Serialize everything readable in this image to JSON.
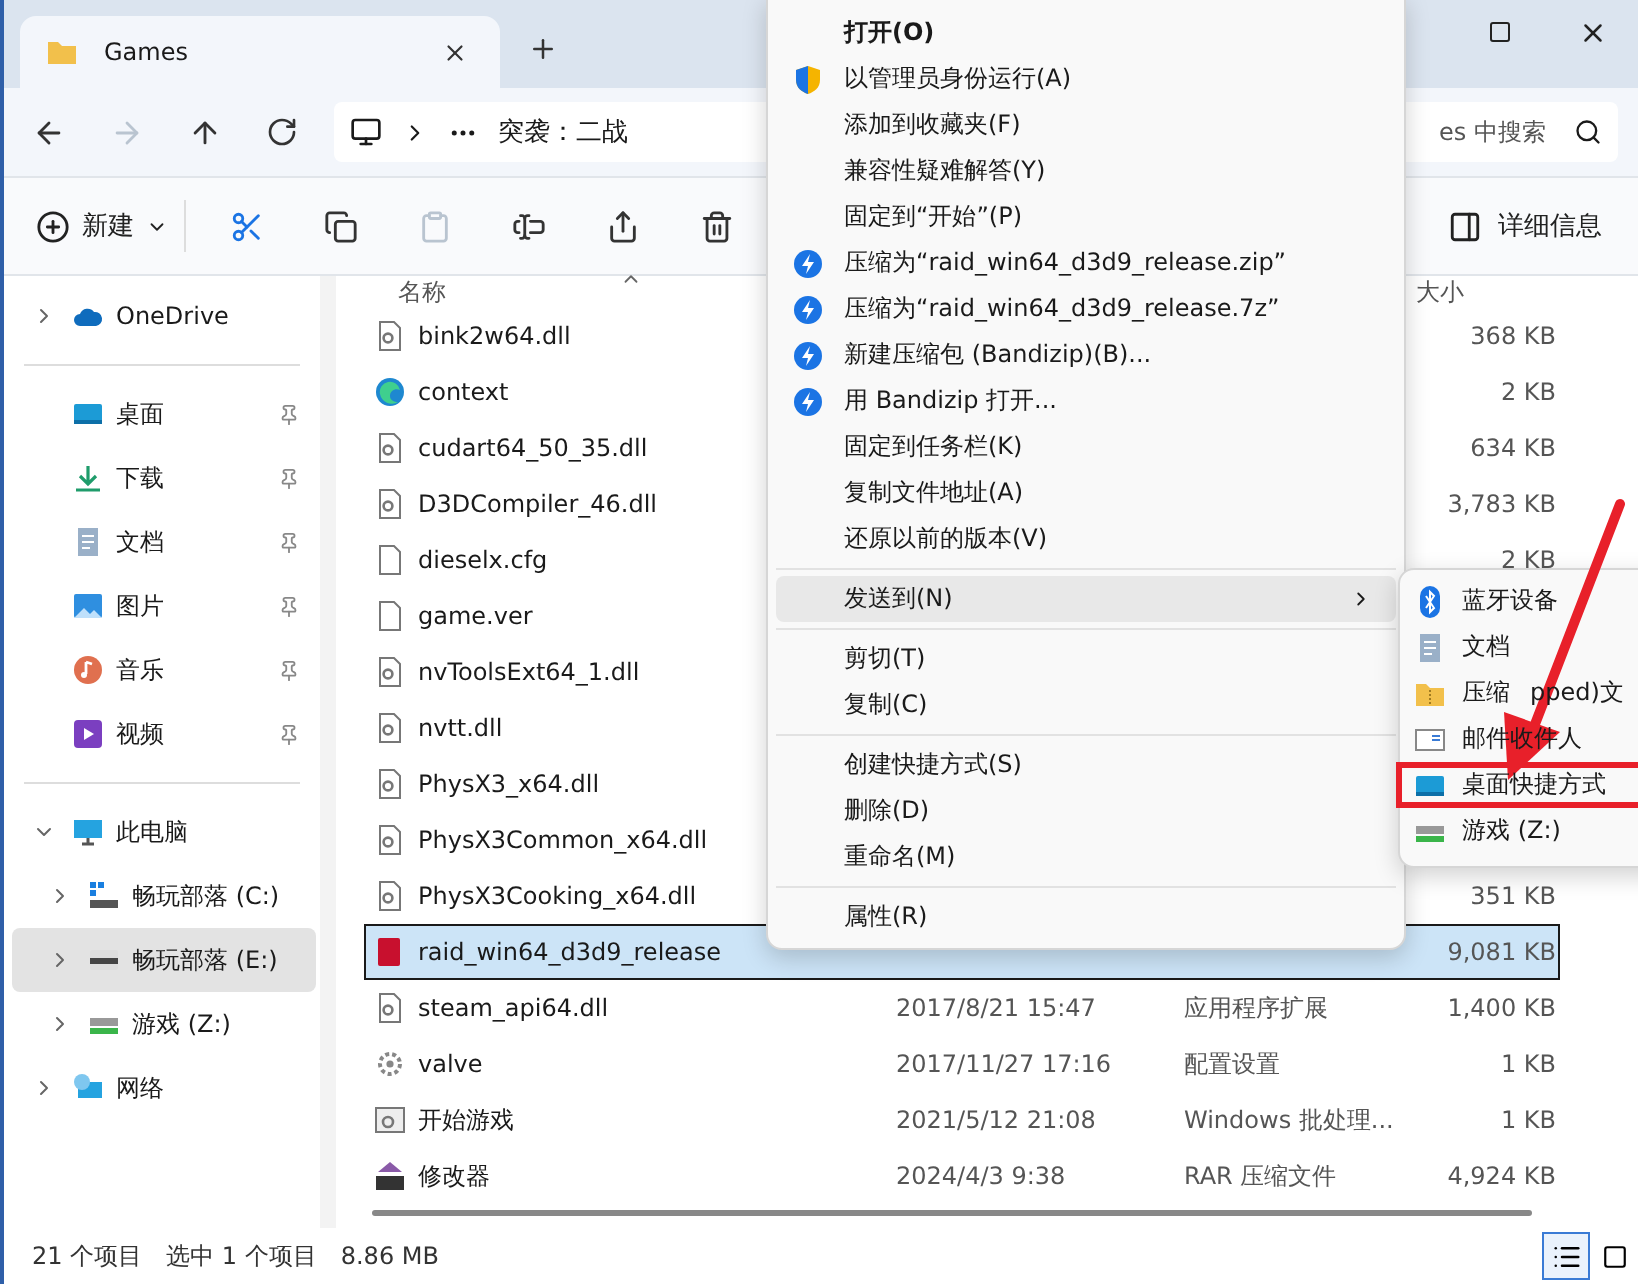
{
  "window": {
    "tab_title": "Games"
  },
  "address": {
    "crumb": "突袭：二战",
    "search_placeholder": "es 中搜索"
  },
  "toolbar": {
    "new_label": "新建",
    "details_label": "详细信息",
    "actions": [
      {
        "kind": "cut",
        "disabled": false
      },
      {
        "kind": "copy",
        "disabled": false
      },
      {
        "kind": "paste",
        "disabled": true
      },
      {
        "kind": "rename",
        "disabled": false
      },
      {
        "kind": "share",
        "disabled": false
      },
      {
        "kind": "delete",
        "disabled": false
      }
    ]
  },
  "sidebar": {
    "items": [
      {
        "label": "OneDrive",
        "kind": "onedrive",
        "expanded": false,
        "pinned": false,
        "selected": false
      },
      {
        "kind": "separator"
      },
      {
        "label": "桌面",
        "kind": "desktop",
        "pinned": true,
        "selected": false
      },
      {
        "label": "下载",
        "kind": "download",
        "pinned": true,
        "selected": false
      },
      {
        "label": "文档",
        "kind": "documents",
        "pinned": true,
        "selected": false
      },
      {
        "label": "图片",
        "kind": "pictures",
        "pinned": true,
        "selected": false
      },
      {
        "label": "音乐",
        "kind": "music",
        "pinned": true,
        "selected": false
      },
      {
        "label": "视频",
        "kind": "video",
        "pinned": true,
        "selected": false
      },
      {
        "kind": "separator"
      },
      {
        "label": "此电脑",
        "kind": "pc",
        "expanded": true,
        "pinned": false,
        "selected": false,
        "children": [
          {
            "label": "畅玩部落 (C:)",
            "kind": "drive_system",
            "expanded": false,
            "selected": false
          },
          {
            "label": "畅玩部落 (E:)",
            "kind": "drive",
            "expanded": false,
            "selected": true
          },
          {
            "label": "游戏 (Z:)",
            "kind": "drive_game",
            "expanded": false,
            "selected": false
          }
        ]
      },
      {
        "label": "网络",
        "kind": "network",
        "expanded": false,
        "pinned": false,
        "selected": false
      }
    ]
  },
  "file_list": {
    "columns": {
      "name": "名称",
      "size": "大小"
    },
    "rows": [
      {
        "name": "bink2w64.dll",
        "kind": "dll",
        "size": "368 KB",
        "selected": false
      },
      {
        "name": "context",
        "kind": "edge",
        "size": "2 KB",
        "selected": false
      },
      {
        "name": "cudart64_50_35.dll",
        "kind": "dll",
        "size": "634 KB",
        "selected": false
      },
      {
        "name": "D3DCompiler_46.dll",
        "kind": "dll",
        "size": "3,783 KB",
        "selected": false
      },
      {
        "name": "dieselx.cfg",
        "kind": "blank",
        "size": "2 KB",
        "selected": false
      },
      {
        "name": "game.ver",
        "kind": "blank",
        "selected": false
      },
      {
        "name": "nvToolsExt64_1.dll",
        "kind": "dll",
        "selected": false
      },
      {
        "name": "nvtt.dll",
        "kind": "dll",
        "selected": false
      },
      {
        "name": "PhysX3_x64.dll",
        "kind": "dll",
        "selected": false
      },
      {
        "name": "PhysX3Common_x64.dll",
        "kind": "dll",
        "selected": false
      },
      {
        "name": "PhysX3Cooking_x64.dll",
        "kind": "dll",
        "size": "351 KB",
        "selected": false
      },
      {
        "name": "raid_win64_d3d9_release",
        "kind": "app",
        "size": "9,081 KB",
        "selected": true
      },
      {
        "name": "steam_api64.dll",
        "kind": "dll",
        "date": "2017/8/21 15:47",
        "type": "应用程序扩展",
        "size": "1,400 KB",
        "selected": false
      },
      {
        "name": "valve",
        "kind": "settings",
        "date": "2017/11/27 17:16",
        "type": "配置设置",
        "size": "1 KB",
        "selected": false
      },
      {
        "name": "开始游戏",
        "kind": "batch",
        "date": "2021/5/12 21:08",
        "type": "Windows 批处理...",
        "size": "1 KB",
        "selected": false
      },
      {
        "name": "修改器",
        "kind": "rar",
        "date": "2024/4/3 9:38",
        "type": "RAR 压缩文件",
        "size": "4,924 KB",
        "selected": false
      }
    ]
  },
  "context_menu": {
    "groups": [
      [
        {
          "label": "打开(O)",
          "kind": "plain",
          "bold": true,
          "selected": false
        },
        {
          "label": "以管理员身份运行(A)",
          "kind": "shield",
          "selected": false
        },
        {
          "label": "添加到收藏夹(F)",
          "kind": "plain",
          "selected": false
        },
        {
          "label": "兼容性疑难解答(Y)",
          "kind": "plain",
          "selected": false
        },
        {
          "label": "固定到“开始”(P)",
          "kind": "plain",
          "selected": false
        },
        {
          "label": "压缩为“raid_win64_d3d9_release.zip”",
          "kind": "bandizip",
          "selected": false
        },
        {
          "label": "压缩为“raid_win64_d3d9_release.7z”",
          "kind": "bandizip",
          "selected": false
        },
        {
          "label": "新建压缩包 (Bandizip)(B)...",
          "kind": "bandizip",
          "selected": false
        },
        {
          "label": "用 Bandizip 打开...",
          "kind": "bandizip",
          "selected": false
        },
        {
          "label": "固定到任务栏(K)",
          "kind": "plain",
          "selected": false
        },
        {
          "label": "复制文件地址(A)",
          "kind": "plain",
          "selected": false
        },
        {
          "label": "还原以前的版本(V)",
          "kind": "plain",
          "selected": false
        }
      ],
      [
        {
          "label": "发送到(N)",
          "kind": "plain",
          "submenu": true,
          "selected": true
        }
      ],
      [
        {
          "label": "剪切(T)",
          "kind": "plain",
          "selected": false
        },
        {
          "label": "复制(C)",
          "kind": "plain",
          "selected": false
        }
      ],
      [
        {
          "label": "创建快捷方式(S)",
          "kind": "plain",
          "selected": false
        },
        {
          "label": "删除(D)",
          "kind": "plain",
          "selected": false
        },
        {
          "label": "重命名(M)",
          "kind": "plain",
          "selected": false
        }
      ],
      [
        {
          "label": "属性(R)",
          "kind": "plain",
          "selected": false
        }
      ]
    ]
  },
  "send_to_menu": {
    "items": [
      {
        "label": "蓝牙设备",
        "kind": "bluetooth",
        "selected": false
      },
      {
        "label": "文档",
        "kind": "documents",
        "selected": false
      },
      {
        "label": "压缩",
        "label_tail": "pped)文",
        "kind": "zip",
        "selected": false
      },
      {
        "label": "邮件收件人",
        "kind": "mail",
        "selected": false
      },
      {
        "label": "桌面快捷方式",
        "kind": "desktop",
        "selected": true
      },
      {
        "label": "游戏 (Z:)",
        "kind": "drive_game",
        "selected": false
      }
    ]
  },
  "status_bar": {
    "count": "21 个项目",
    "selection": "选中 1 个项目",
    "selection_size": "8.86 MB",
    "view_buttons": [
      {
        "kind": "details",
        "selected": true
      },
      {
        "kind": "tiles",
        "selected": false
      }
    ]
  }
}
